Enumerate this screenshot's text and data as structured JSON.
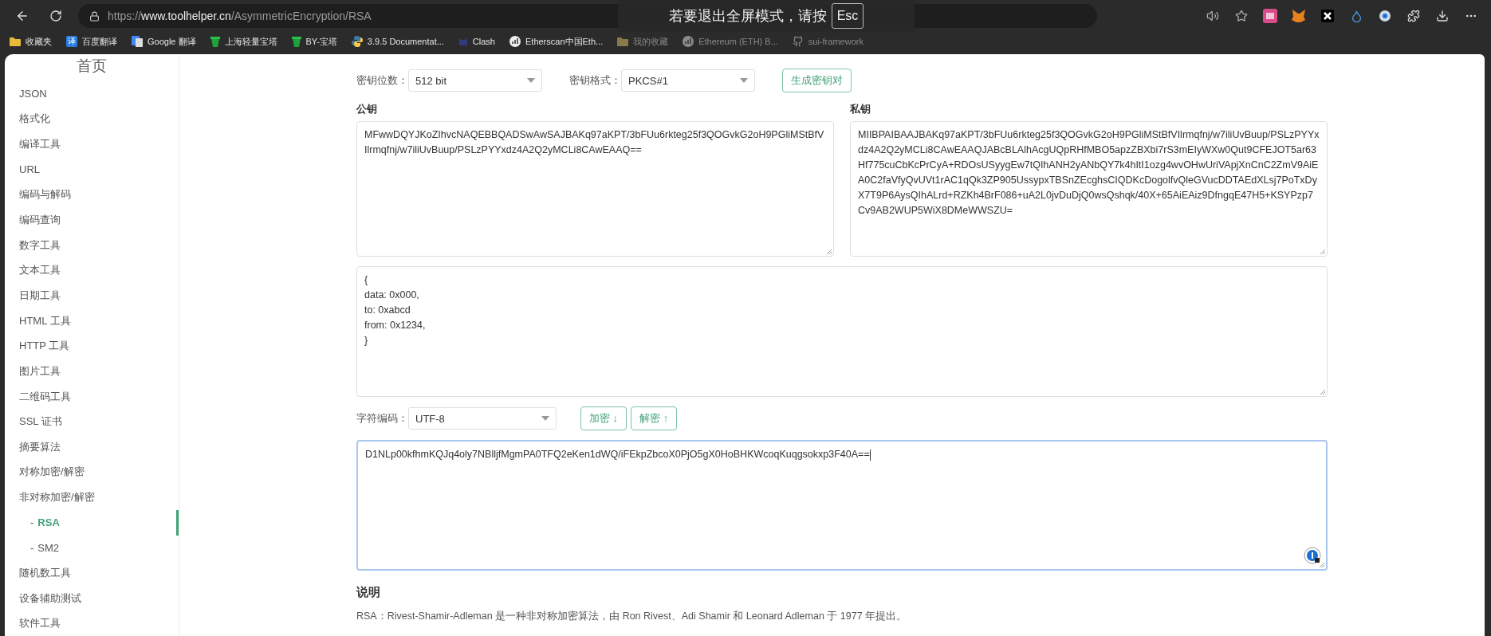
{
  "browser": {
    "address": {
      "scheme": "https://",
      "host": "www.toolhelper.cn",
      "path": "/AsymmetricEncryption/RSA"
    },
    "bookmarks": [
      {
        "kind": "folder",
        "label": "收藏夹",
        "dimmed": false
      },
      {
        "kind": "badge",
        "badge_text": "译",
        "label": "百度翻译",
        "dimmed": false
      },
      {
        "kind": "google",
        "label": "Google 翻译",
        "dimmed": false
      },
      {
        "kind": "tower",
        "label": "上海轻量宝塔",
        "dimmed": false
      },
      {
        "kind": "tower",
        "label": "BY-宝塔",
        "dimmed": false
      },
      {
        "kind": "python",
        "label": "3.9.5 Documentat...",
        "dimmed": false
      },
      {
        "kind": "clash",
        "label": "Clash",
        "dimmed": false
      },
      {
        "kind": "circle",
        "label": "Etherscan中国Eth...",
        "dimmed": false
      },
      {
        "kind": "folder",
        "label": "我的收藏",
        "dimmed": true
      },
      {
        "kind": "circle",
        "label": "Ethereum (ETH) B...",
        "dimmed": true
      },
      {
        "kind": "github",
        "label": "sui-framework",
        "dimmed": true
      }
    ],
    "fullscreen_notice": {
      "text": "若要退出全屏模式，请按",
      "key": "Esc"
    }
  },
  "sidebar": {
    "title": "首页",
    "items": [
      {
        "label": "JSON",
        "selected": false
      },
      {
        "label": "格式化",
        "selected": false
      },
      {
        "label": "编译工具",
        "selected": false
      },
      {
        "label": "URL",
        "selected": false
      },
      {
        "label": "编码与解码",
        "selected": false
      },
      {
        "label": "编码查询",
        "selected": false
      },
      {
        "label": "数字工具",
        "selected": false
      },
      {
        "label": "文本工具",
        "selected": false
      },
      {
        "label": "日期工具",
        "selected": false
      },
      {
        "label": "HTML 工具",
        "selected": false
      },
      {
        "label": "HTTP 工具",
        "selected": false
      },
      {
        "label": "图片工具",
        "selected": false
      },
      {
        "label": "二维码工具",
        "selected": false
      },
      {
        "label": "SSL 证书",
        "selected": false
      },
      {
        "label": "摘要算法",
        "selected": false
      },
      {
        "label": "对称加密/解密",
        "selected": false
      },
      {
        "label": "非对称加密/解密",
        "selected": false,
        "children": [
          {
            "marker": "-",
            "label": "RSA",
            "selected": true
          },
          {
            "marker": "-",
            "label": "SM2",
            "selected": false
          }
        ]
      },
      {
        "label": "随机数工具",
        "selected": false
      },
      {
        "label": "设备辅助测试",
        "selected": false
      },
      {
        "label": "软件工具",
        "selected": false
      }
    ]
  },
  "form": {
    "key_size": {
      "label": "密钥位数：",
      "value": "512 bit"
    },
    "key_format": {
      "label": "密钥格式：",
      "value": "PKCS#1"
    },
    "generate_button": "生成密钥对"
  },
  "public_key": {
    "label": "公钥",
    "value": "MFwwDQYJKoZIhvcNAQEBBQADSwAwSAJBAKq97aKPT/3bFUu6rkteg25f3QOGvkG2oH9PGliMStBfVIlrmqfnj/w7iliUvBuup/PSLzPYYxdz4A2Q2yMCLi8CAwEAAQ=="
  },
  "private_key": {
    "label": "私钥",
    "value": "MIIBPAIBAAJBAKq97aKPT/3bFUu6rkteg25f3QOGvkG2oH9PGliMStBfVIlrmqfnj/w7iliUvBuup/PSLzPYYxdz4A2Q2yMCLi8CAwEAAQJABcBLAlhAcgUQpRHfMBO5apzZBXbi7rS3mEIyWXw0Qut9CFEJOT5ar63Hf775cuCbKcPrCyA+RDOsUSyygEw7tQIhANH2yANbQY7k4hItI1ozg4wvOHwUriVApjXnCnC2ZmV9AiEA0C2faVfyQvUVt1rAC1qQk3ZP905UssypxTBSnZEcghsCIQDKcDogolfvQleGVucDDTAEdXLsj7PoTxDyX7T9P6AysQIhALrd+RZKh4BrF086+uA2L0jvDuDjQ0wsQshqk/40X+65AiEAiz9DfngqE47H5+KSYPzp7Cv9AB2WUP5WiX8DMeWWSZU="
  },
  "message": {
    "value": "{\ndata: 0x000,\nto: 0xabcd\nfrom: 0x1234,\n}"
  },
  "charset": {
    "label": "字符编码：",
    "value": "UTF-8"
  },
  "actions": [
    {
      "label": "加密 ↓"
    },
    {
      "label": "解密 ↑"
    }
  ],
  "ciphertext": {
    "value": "D1NLp00kfhmKQJq4oly7NBlljfMgmPA0TFQ2eKen1dWQ/iFEkpZbcoX0PjO5gX0HoBHKWcoqKuqgsokxp3F40A==",
    "focused": true
  },
  "description": {
    "title": "说明",
    "text": "RSA：Rivest-Shamir-Adleman 是一种非对称加密算法，由 Ron Rivest、Adi Shamir 和 Leonard Adleman 于 1977 年提出。"
  }
}
